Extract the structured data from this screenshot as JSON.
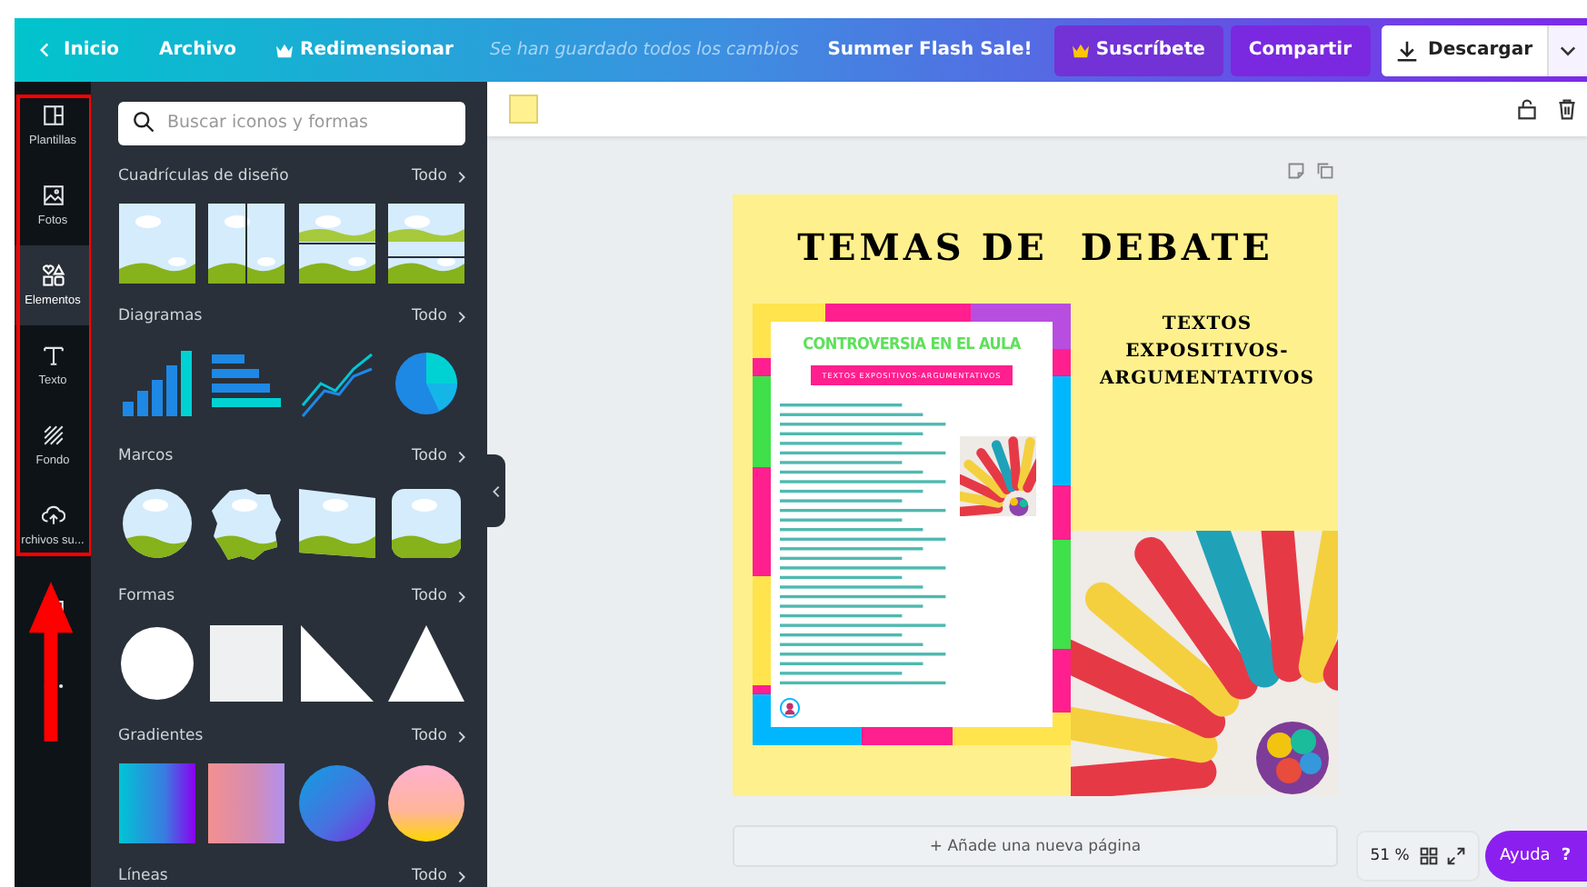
{
  "topbar": {
    "back": "Inicio",
    "file": "Archivo",
    "resize": "Redimensionar",
    "save_status": "Se han guardado todos los cambios",
    "sale": "Summer Flash Sale!",
    "subscribe": "Suscríbete",
    "share": "Compartir",
    "download": "Descargar"
  },
  "rail": [
    {
      "kind": "templates",
      "label": "Plantillas",
      "selected": false
    },
    {
      "kind": "photos",
      "label": "Fotos",
      "selected": false
    },
    {
      "kind": "elements",
      "label": "Elementos",
      "selected": true
    },
    {
      "kind": "text",
      "label": "Texto",
      "selected": false
    },
    {
      "kind": "background",
      "label": "Fondo",
      "selected": false
    },
    {
      "kind": "uploads",
      "label": "rchivos su...",
      "selected": false
    },
    {
      "kind": "folder",
      "selected": false
    },
    {
      "kind": "more",
      "selected": false
    }
  ],
  "search": {
    "placeholder": "Buscar iconos y formas"
  },
  "sections": [
    {
      "kind": "grids",
      "title": "Cuadrículas de diseño",
      "more": "Todo"
    },
    {
      "kind": "charts",
      "title": "Diagramas",
      "more": "Todo"
    },
    {
      "kind": "frames",
      "title": "Marcos",
      "more": "Todo"
    },
    {
      "kind": "shapes",
      "title": "Formas",
      "more": "Todo"
    },
    {
      "kind": "gradients",
      "title": "Gradientes",
      "more": "Todo"
    },
    {
      "kind": "lines",
      "title": "Líneas",
      "more": "Todo"
    }
  ],
  "toolbar": {
    "color": "#fff18f"
  },
  "page": {
    "title": "TEMAS DE  DEBATE",
    "subtitle": "TEXTOS EXPOSITIVOS-ARGUMENTATIVOS",
    "flyer_title": "CONTROVERSIA EN EL AULA",
    "flyer_banner": "TEXTOS EXPOSITIVOS-ARGUMENTATIVOS"
  },
  "add_page": "+ Añade una nueva página",
  "zoom": "51 %",
  "help": {
    "label": "Ayuda",
    "icon": "?"
  }
}
